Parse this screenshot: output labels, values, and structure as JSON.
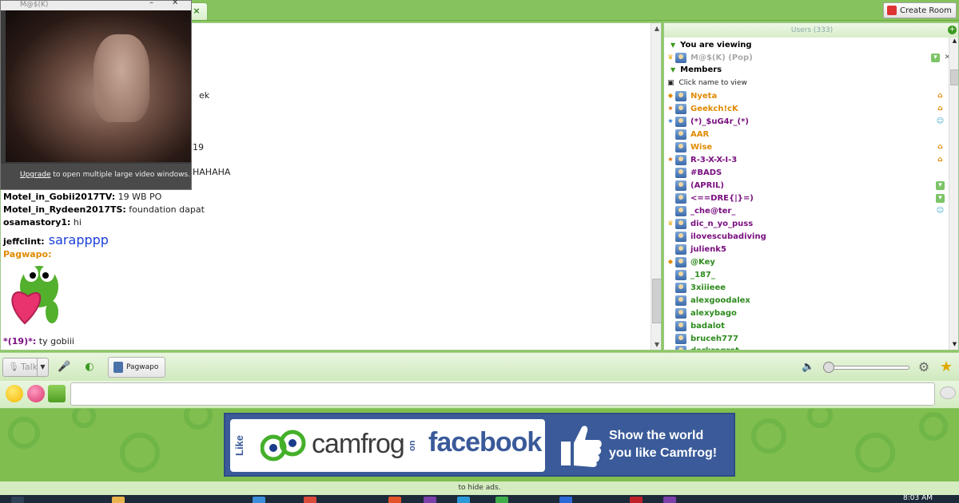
{
  "window": {
    "video_title": "M@$(K)",
    "create_room_label": "Create Room",
    "tab_close": "×"
  },
  "video": {
    "upgrade_link": "Upgrade",
    "upgrade_text": " to open multiple large video windows."
  },
  "chat": {
    "partial_lines": [
      "ek",
      "19",
      "HAHAHA"
    ],
    "messages": [
      {
        "nick": "Motel_in_Gobii2017TV:",
        "text": " 19 WB PO"
      },
      {
        "nick": "Motel_in_Rydeen2017TS:",
        "text": " foundation dapat"
      },
      {
        "nick": "osamastory1:",
        "text": " hi"
      },
      {
        "nick": "jeffclint:",
        "text": " sarapppp"
      },
      {
        "nick": "Pagwapo:",
        "text": ""
      },
      {
        "nick": "*(19)*:",
        "text": " ty gobiii"
      }
    ]
  },
  "users": {
    "header": "Users (333)",
    "you_are_viewing": "You are viewing",
    "viewing_user": "M@$(K) (Pop)",
    "members_label": "Members",
    "click_hint": "Click name to view",
    "list": [
      {
        "name": "Nyeta",
        "color": "#e08a00"
      },
      {
        "name": "Geekch!cK",
        "color": "#e08a00"
      },
      {
        "name": "(*)_$uG4r_(*)",
        "color": "#7a1080"
      },
      {
        "name": "AAR",
        "color": "#e08a00"
      },
      {
        "name": "Wise",
        "color": "#e08a00"
      },
      {
        "name": "R-3-X-X-I-3",
        "color": "#7a1080"
      },
      {
        "name": "#BADS",
        "color": "#7a1080"
      },
      {
        "name": "(APRIL)",
        "color": "#7a1080"
      },
      {
        "name": "<==DRE{|}=)",
        "color": "#7a1080"
      },
      {
        "name": "_che@ter_",
        "color": "#7a1080"
      },
      {
        "name": "dic_n_yo_puss",
        "color": "#7a1080"
      },
      {
        "name": "ilovescubadiving",
        "color": "#7a1080"
      },
      {
        "name": "julienk5",
        "color": "#7a1080"
      },
      {
        "name": "@Key",
        "color": "#2e8b1e"
      },
      {
        "name": "_187_",
        "color": "#2e8b1e"
      },
      {
        "name": "3xiiieee",
        "color": "#2e8b1e"
      },
      {
        "name": "alexgoodalex",
        "color": "#2e8b1e"
      },
      {
        "name": "alexybago",
        "color": "#2e8b1e"
      },
      {
        "name": "badalot",
        "color": "#2e8b1e"
      },
      {
        "name": "bruceh777",
        "color": "#2e8b1e"
      },
      {
        "name": "darkregret",
        "color": "#2e8b1e"
      }
    ]
  },
  "toolbar": {
    "talk_label": "Talk",
    "cam_user": "Pagwapo",
    "volume_level": 0
  },
  "ad": {
    "like": "Like",
    "camfrog": "camfrog",
    "on": "on",
    "facebook": "facebook",
    "tagline_1": "Show the world",
    "tagline_2": "you like Camfrog!",
    "hide_ads": "to hide ads."
  },
  "taskbar": {
    "clock": "8:03 AM"
  }
}
